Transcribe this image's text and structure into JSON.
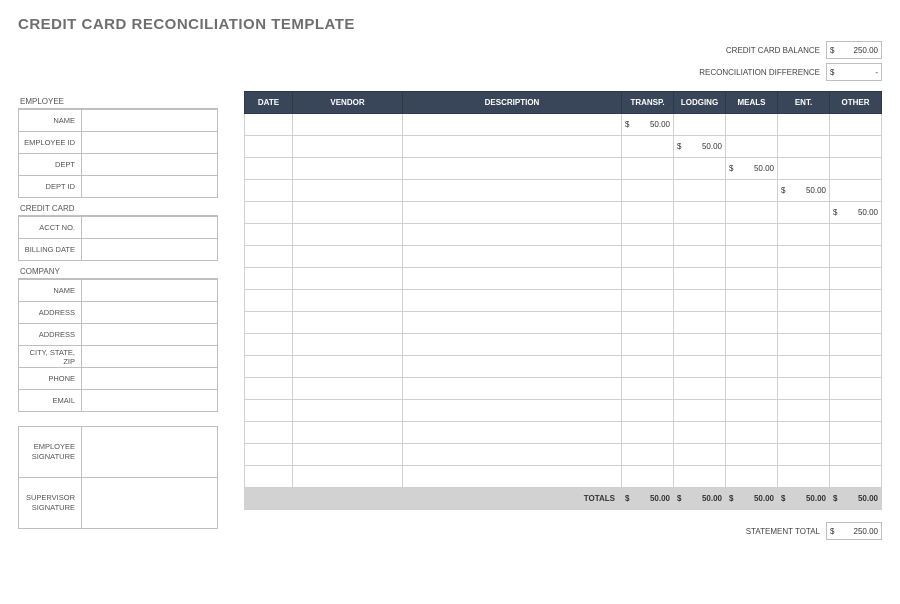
{
  "title": "CREDIT CARD RECONCILIATION TEMPLATE",
  "summary": {
    "balance_label": "CREDIT CARD BALANCE",
    "balance_currency": "$",
    "balance_value": "250.00",
    "diff_label": "RECONCILIATION DIFFERENCE",
    "diff_currency": "$",
    "diff_value": "-"
  },
  "sections": {
    "employee": {
      "head": "EMPLOYEE",
      "name": "NAME",
      "employee_id": "EMPLOYEE ID",
      "dept": "DEPT",
      "dept_id": "DEPT ID"
    },
    "credit_card": {
      "head": "CREDIT CARD",
      "acct_no": "ACCT NO.",
      "billing_date": "BILLING DATE"
    },
    "company": {
      "head": "COMPANY",
      "name": "NAME",
      "address1": "ADDRESS",
      "address2": "ADDRESS",
      "csz": "CITY, STATE, ZIP",
      "phone": "PHONE",
      "email": "EMAIL"
    },
    "sig": {
      "employee": "EMPLOYEE SIGNATURE",
      "supervisor": "SUPERVISOR SIGNATURE"
    }
  },
  "grid": {
    "headers": {
      "date": "DATE",
      "vendor": "VENDOR",
      "description": "DESCRIPTION",
      "transp": "TRANSP.",
      "lodging": "LODGING",
      "meals": "MEALS",
      "ent": "ENT.",
      "other": "OTHER"
    },
    "currency": "$",
    "rows": [
      {
        "transp": "50.00"
      },
      {
        "lodging": "50.00"
      },
      {
        "meals": "50.00"
      },
      {
        "ent": "50.00"
      },
      {
        "other": "50.00"
      },
      {},
      {},
      {},
      {},
      {},
      {},
      {},
      {},
      {},
      {},
      {},
      {}
    ],
    "totals_label": "TOTALS",
    "totals": {
      "transp": "50.00",
      "lodging": "50.00",
      "meals": "50.00",
      "ent": "50.00",
      "other": "50.00"
    }
  },
  "statement_total": {
    "label": "STATEMENT TOTAL",
    "currency": "$",
    "value": "250.00"
  }
}
